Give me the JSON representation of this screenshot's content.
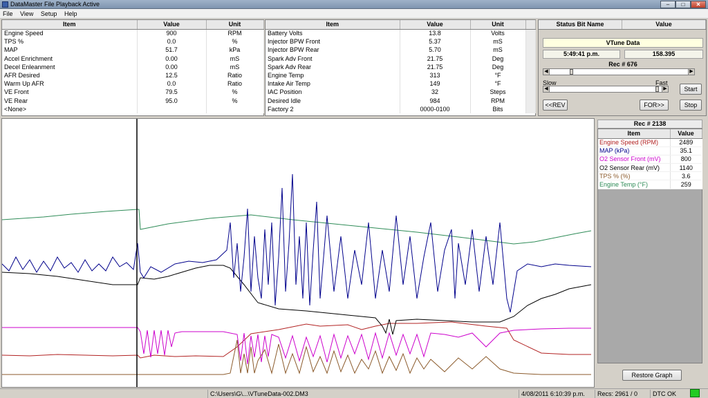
{
  "window": {
    "title": "DataMaster File Playback Active"
  },
  "menu": [
    "File",
    "View",
    "Setup",
    "Help"
  ],
  "left_table": {
    "headers": [
      "Item",
      "Value",
      "Unit"
    ],
    "rows": [
      [
        "Engine Speed",
        "900",
        "RPM"
      ],
      [
        "TPS %",
        "0.0",
        "%"
      ],
      [
        "MAP",
        "51.7",
        "kPa"
      ],
      [
        "Accel Enrichment",
        "0.00",
        "mS"
      ],
      [
        "Decel Enleanment",
        "0.00",
        "mS"
      ],
      [
        "AFR Desired",
        "12.5",
        "Ratio"
      ],
      [
        "Warm Up AFR",
        "0.0",
        "Ratio"
      ],
      [
        "VE Front",
        "79.5",
        "%"
      ],
      [
        "VE Rear",
        "95.0",
        "%"
      ],
      [
        "<None>",
        "",
        ""
      ]
    ]
  },
  "mid_table": {
    "headers": [
      "Item",
      "Value",
      "Unit"
    ],
    "rows": [
      [
        "Battery Volts",
        "13.8",
        "Volts"
      ],
      [
        "Injector BPW Front",
        "5.37",
        "mS"
      ],
      [
        "Injector BPW Rear",
        "5.70",
        "mS"
      ],
      [
        "Spark Adv Front",
        "21.75",
        "Deg"
      ],
      [
        "Spark Adv Rear",
        "21.75",
        "Deg"
      ],
      [
        "Engine Temp",
        "313",
        "°F"
      ],
      [
        "Intake Air Temp",
        "149",
        "°F"
      ],
      [
        "IAC Position",
        "32",
        "Steps"
      ],
      [
        "Desired Idle",
        "984",
        "RPM"
      ],
      [
        "Factory 2",
        "0000-0100",
        "Bits"
      ]
    ]
  },
  "status_panel": {
    "headers": [
      "Status Bit Name",
      "Value"
    ],
    "title": "VTune Data",
    "time": "5:49:41 p.m.",
    "value": "158.395",
    "rec": "Rec # 676",
    "slow": "Slow",
    "fast": "Fast",
    "rev_label": "<<REV",
    "for_label": "FOR>>",
    "start_label": "Start",
    "stop_label": "Stop",
    "rec_position": 0.15,
    "speed_position": 0.98
  },
  "legend": {
    "rec": "Rec # 2138",
    "headers": [
      "Item",
      "Value"
    ],
    "items": [
      {
        "name": "Engine Speed (RPM)",
        "value": "2489",
        "color": "#b22222"
      },
      {
        "name": "MAP (kPa)",
        "value": "35.1",
        "color": "#00008b"
      },
      {
        "name": "O2 Sensor Front (mV)",
        "value": "800",
        "color": "#cc00cc"
      },
      {
        "name": "O2 Sensor Rear (mV)",
        "value": "1140",
        "color": "#000000"
      },
      {
        "name": "TPS % (%)",
        "value": "3.6",
        "color": "#8b5a2b"
      },
      {
        "name": "Engine Temp (°F)",
        "value": "259",
        "color": "#2e8b57"
      }
    ],
    "restore_label": "Restore Graph"
  },
  "statusbar": {
    "file": "C:\\Users\\G\\...\\VTuneData-002.DM3",
    "datetime": "4/08/2011  6:10:39 p.m.",
    "recs": "Recs: 2961 / 0",
    "dtc": "DTC OK"
  }
}
